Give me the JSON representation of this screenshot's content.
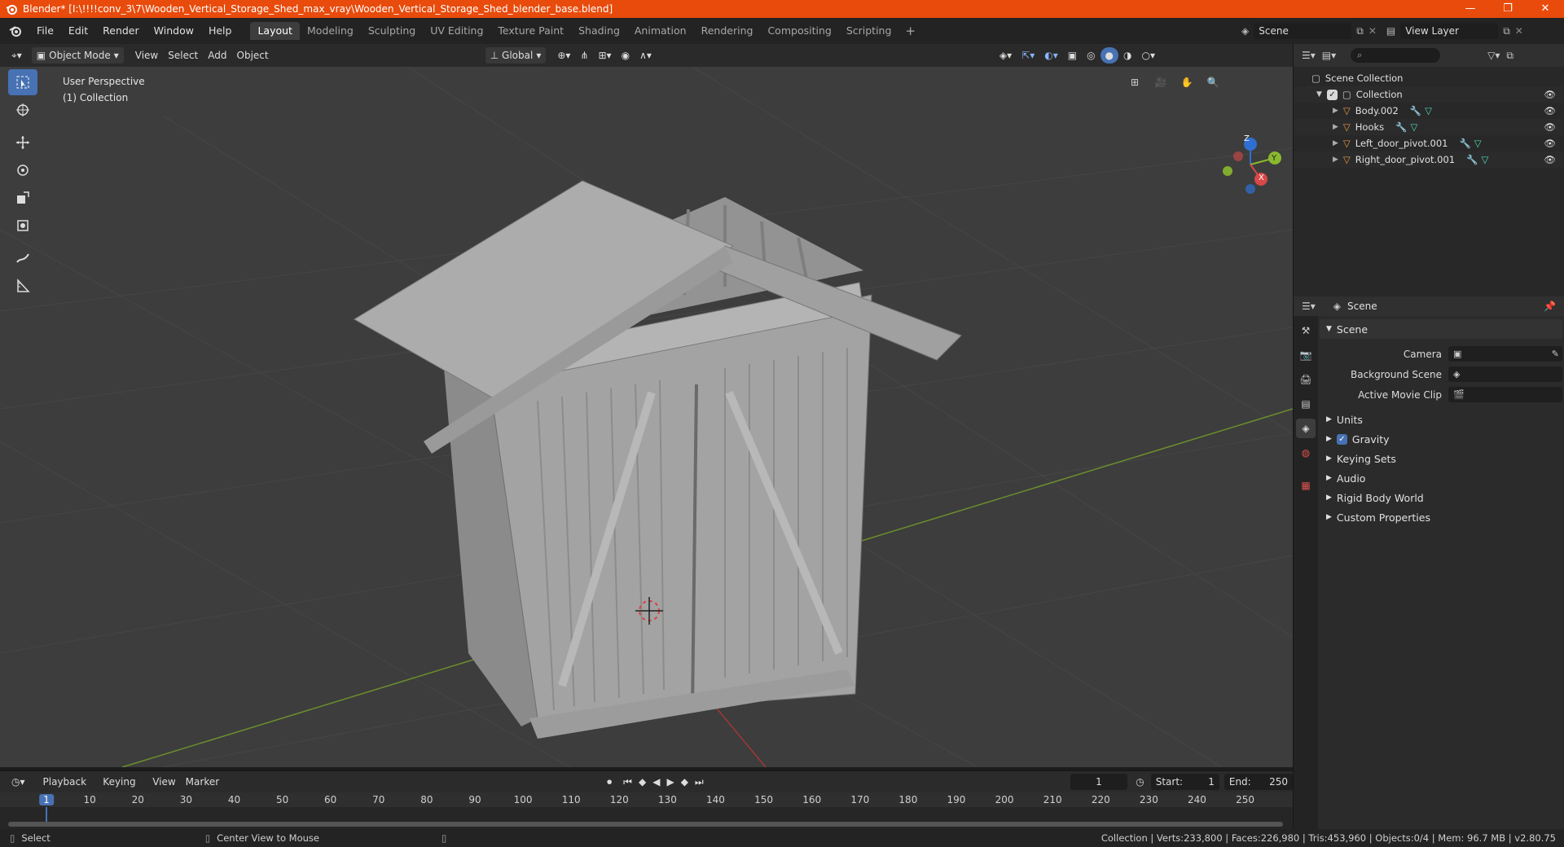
{
  "window": {
    "title": "Blender* [I:\\!!!!conv_3\\7\\Wooden_Vertical_Storage_Shed_max_vray\\Wooden_Vertical_Storage_Shed_blender_base.blend]",
    "controls": [
      "—",
      "❐",
      "✕"
    ]
  },
  "menu": {
    "items": [
      "File",
      "Edit",
      "Render",
      "Window",
      "Help"
    ]
  },
  "workspaces": {
    "tabs": [
      "Layout",
      "Modeling",
      "Sculpting",
      "UV Editing",
      "Texture Paint",
      "Shading",
      "Animation",
      "Rendering",
      "Compositing",
      "Scripting"
    ],
    "active": "Layout"
  },
  "scene_selector": {
    "scene": "Scene",
    "view_layer": "View Layer"
  },
  "viewport_header": {
    "mode": "Object Mode",
    "menus": [
      "View",
      "Select",
      "Add",
      "Object"
    ],
    "orientation": "Global"
  },
  "viewport": {
    "perspective": "User Perspective",
    "collection": "(1) Collection",
    "gizmo": {
      "x": "X",
      "y": "Y",
      "z": "Z"
    }
  },
  "outliner": {
    "root": "Scene Collection",
    "collection": "Collection",
    "objects": [
      "Body.002",
      "Hooks",
      "Left_door_pivot.001",
      "Right_door_pivot.001"
    ]
  },
  "properties": {
    "header": "Scene",
    "section_scene": "Scene",
    "camera_label": "Camera",
    "background_label": "Background Scene",
    "movie_clip_label": "Active Movie Clip",
    "sections": [
      "Units",
      "Gravity",
      "Keying Sets",
      "Audio",
      "Rigid Body World",
      "Custom Properties"
    ]
  },
  "timeline": {
    "menus": [
      "Playback",
      "Keying",
      "View",
      "Marker"
    ],
    "current_frame": "1",
    "start_label": "Start:",
    "start": "1",
    "end_label": "End:",
    "end": "250",
    "ticks": [
      "1",
      "10",
      "20",
      "30",
      "40",
      "50",
      "60",
      "70",
      "80",
      "90",
      "100",
      "110",
      "120",
      "130",
      "140",
      "150",
      "160",
      "170",
      "180",
      "190",
      "200",
      "210",
      "220",
      "230",
      "240",
      "250"
    ]
  },
  "status": {
    "left1": "Select",
    "left2": "Center View to Mouse",
    "right": "Collection | Verts:233,800 | Faces:226,980 | Tris:453,960 | Objects:0/4 | Mem: 96.7 MB | v2.80.75"
  },
  "colors": {
    "accent": "#4772b3",
    "titlebar": "#e84b0c",
    "object_icon": "#e8974c"
  }
}
